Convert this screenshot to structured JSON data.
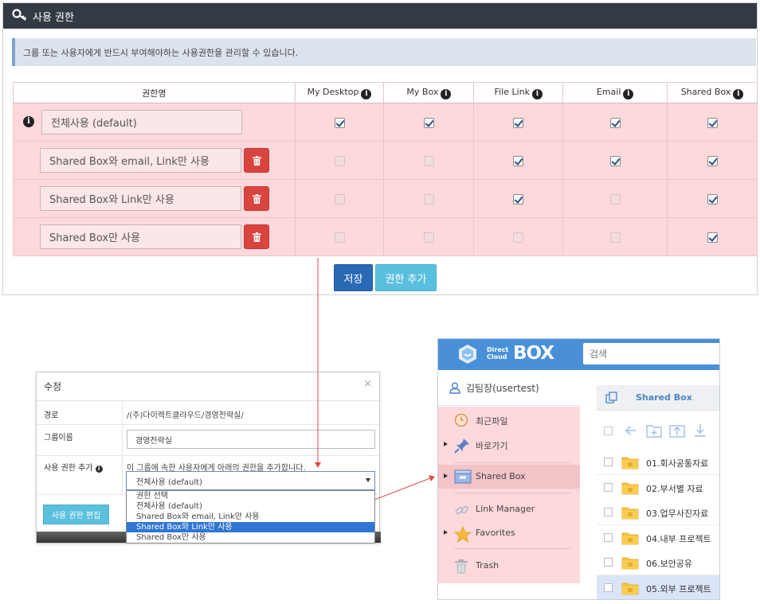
{
  "panel": {
    "title": "사용 권한",
    "notice": "그룹 또는 사용자에게 반드시 부여해야하는 사용권한을 관리할 수 있습니다.",
    "columns": [
      "권한명",
      "My Desktop",
      "My Box",
      "File Link",
      "Email",
      "Shared Box"
    ],
    "rows": [
      {
        "name": "전체사용 (default)",
        "deletable": false,
        "perms": [
          true,
          true,
          true,
          true,
          true
        ]
      },
      {
        "name": "Shared Box와 email, Link만 사용",
        "deletable": true,
        "perms": [
          false,
          false,
          true,
          true,
          true
        ]
      },
      {
        "name": "Shared Box와 Link만 사용",
        "deletable": true,
        "perms": [
          false,
          false,
          true,
          false,
          true
        ]
      },
      {
        "name": "Shared Box만 사용",
        "deletable": true,
        "perms": [
          false,
          false,
          false,
          false,
          true
        ]
      }
    ],
    "save_label": "저장",
    "add_label": "권한 추가"
  },
  "dialog": {
    "title": "수정",
    "close": "×",
    "path_label": "경로",
    "path_value": "/(주)다이렉트클라우드/경영전략실/",
    "group_label": "그룹이름",
    "group_value": "경영전략실",
    "perm_label": "사용 권한 추가",
    "perm_desc": "이 그룹에 속한 사용자에게 아래의 권한을 추가합니다.",
    "select_value": "전체사용 (default)",
    "options": [
      "권한 선택",
      "전체사용 (default)",
      "Shared Box와 email, Link만 사용",
      "Shared Box와 Link만 사용",
      "Shared Box만 사용"
    ],
    "selected_option": 3,
    "edit_button": "사용 권한 편집"
  },
  "app": {
    "logo_small": "Direct Cloud",
    "logo_small_1": "Direct",
    "logo_small_2": "Cloud",
    "logo_big": "BOX",
    "search_placeholder": "검색",
    "user": "김팀장(usertest)",
    "sidebar": [
      {
        "label": "최근파일",
        "icon": "clock-icon",
        "arrow": false
      },
      {
        "label": "바로가기",
        "icon": "pin-icon",
        "arrow": true
      },
      {
        "label": "Shared Box",
        "icon": "shared-box-icon",
        "arrow": true,
        "active": true
      },
      {
        "label": "Link Manager",
        "icon": "link-icon",
        "arrow": false
      },
      {
        "label": "Favorites",
        "icon": "star-icon",
        "arrow": true
      },
      {
        "label": "Trash",
        "icon": "trash-icon",
        "arrow": false
      }
    ],
    "main_title": "Shared Box",
    "files": [
      {
        "name": "01.회사공통자료",
        "selected": false
      },
      {
        "name": "02.부서별 자료",
        "selected": false
      },
      {
        "name": "03.업무사진자료",
        "selected": false
      },
      {
        "name": "04.내부 프로젝트",
        "selected": false
      },
      {
        "name": "06.보안공유",
        "selected": false
      },
      {
        "name": "05.외부 프로젝트",
        "selected": true
      }
    ]
  },
  "colors": {
    "header_dark": "#333a44",
    "row_pink": "#fdd9dc",
    "save_blue": "#2a6ab5",
    "add_cyan": "#5bc0de",
    "delete_red": "#d9443f",
    "app_blue": "#4990d9",
    "folder_yellow": "#f6c23e",
    "arrow_red": "#e04a4a"
  }
}
